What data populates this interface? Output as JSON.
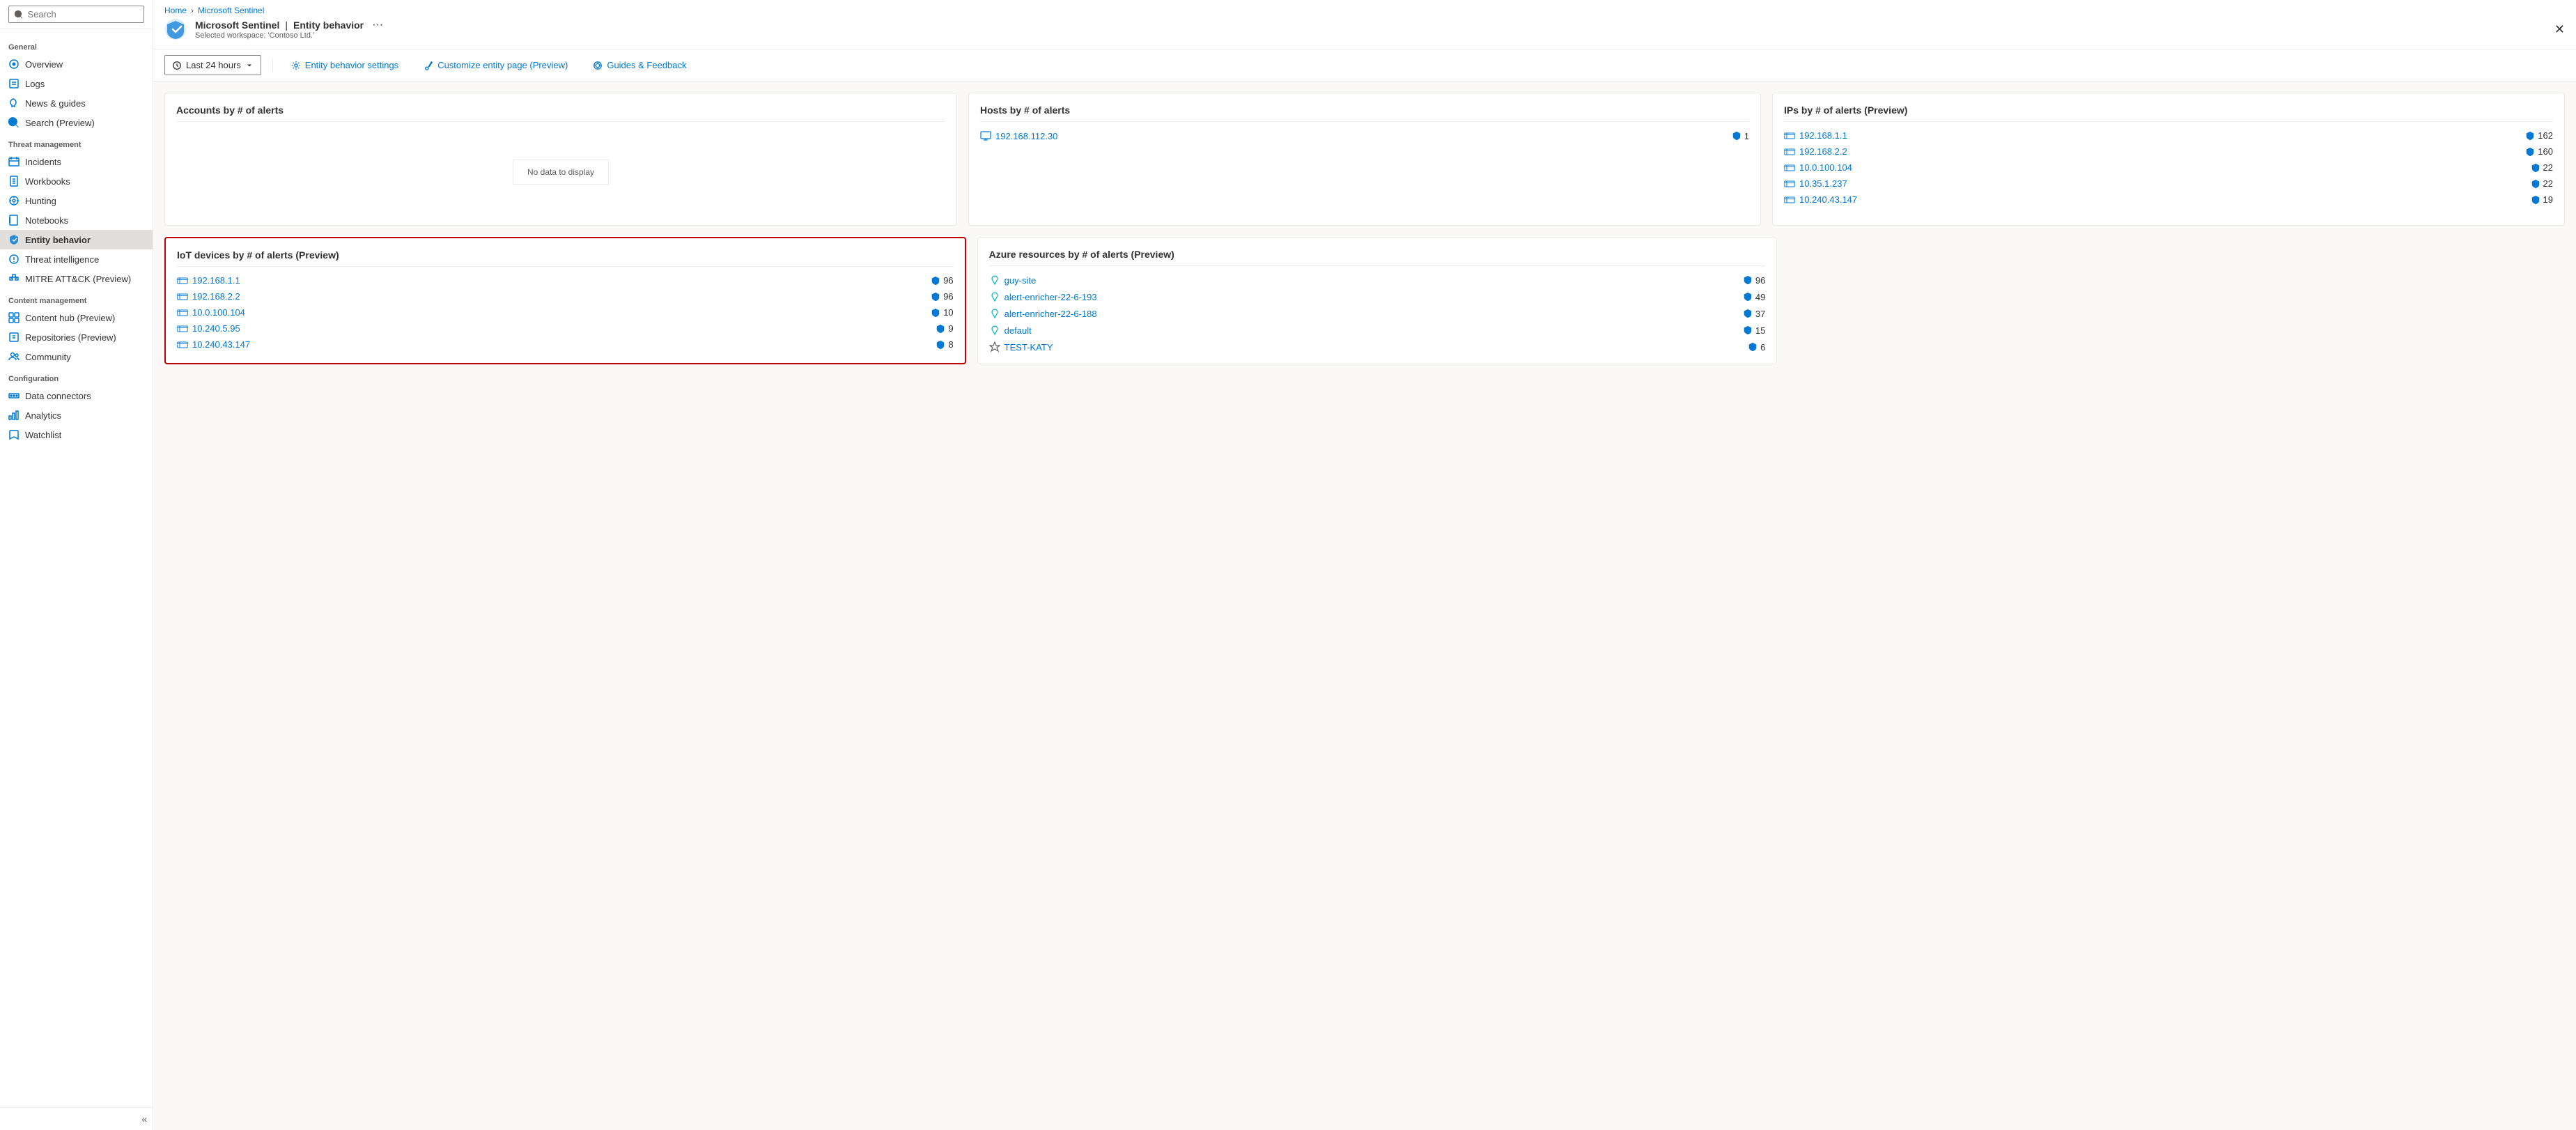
{
  "app": {
    "breadcrumb": [
      "Home",
      "Microsoft Sentinel"
    ],
    "title": "Microsoft Sentinel",
    "page": "Entity behavior",
    "workspace": "Selected workspace: 'Contoso Ltd.'",
    "more_icon": "···",
    "close_icon": "✕"
  },
  "toolbar": {
    "time_range": "Last 24 hours",
    "entity_behavior_settings": "Entity behavior settings",
    "customize_entity_page": "Customize entity page (Preview)",
    "guides_feedback": "Guides & Feedback"
  },
  "sidebar": {
    "search_placeholder": "Search",
    "collapse_label": "«",
    "sections": [
      {
        "label": "General",
        "items": [
          {
            "id": "overview",
            "label": "Overview",
            "icon": "overview"
          },
          {
            "id": "logs",
            "label": "Logs",
            "icon": "logs"
          },
          {
            "id": "news-guides",
            "label": "News & guides",
            "icon": "news"
          },
          {
            "id": "search-preview",
            "label": "Search (Preview)",
            "icon": "search"
          }
        ]
      },
      {
        "label": "Threat management",
        "items": [
          {
            "id": "incidents",
            "label": "Incidents",
            "icon": "incidents"
          },
          {
            "id": "workbooks",
            "label": "Workbooks",
            "icon": "workbooks"
          },
          {
            "id": "hunting",
            "label": "Hunting",
            "icon": "hunting"
          },
          {
            "id": "notebooks",
            "label": "Notebooks",
            "icon": "notebooks"
          },
          {
            "id": "entity-behavior",
            "label": "Entity behavior",
            "icon": "entity",
            "active": true
          },
          {
            "id": "threat-intelligence",
            "label": "Threat intelligence",
            "icon": "threat"
          },
          {
            "id": "mitre-attack",
            "label": "MITRE ATT&CK (Preview)",
            "icon": "mitre"
          }
        ]
      },
      {
        "label": "Content management",
        "items": [
          {
            "id": "content-hub",
            "label": "Content hub (Preview)",
            "icon": "hub"
          },
          {
            "id": "repositories",
            "label": "Repositories (Preview)",
            "icon": "repo"
          },
          {
            "id": "community",
            "label": "Community",
            "icon": "community"
          }
        ]
      },
      {
        "label": "Configuration",
        "items": [
          {
            "id": "data-connectors",
            "label": "Data connectors",
            "icon": "connectors"
          },
          {
            "id": "analytics",
            "label": "Analytics",
            "icon": "analytics"
          },
          {
            "id": "watchlist",
            "label": "Watchlist",
            "icon": "watchlist"
          }
        ]
      }
    ]
  },
  "accounts_card": {
    "title": "Accounts by # of alerts",
    "no_data": "No data to display",
    "items": []
  },
  "hosts_card": {
    "title": "Hosts by # of alerts",
    "items": [
      {
        "name": "192.168.112.30",
        "count": 1
      }
    ]
  },
  "ips_card": {
    "title": "IPs by # of alerts (Preview)",
    "items": [
      {
        "name": "192.168.1.1",
        "count": 162
      },
      {
        "name": "192.168.2.2",
        "count": 160
      },
      {
        "name": "10.0.100.104",
        "count": 22
      },
      {
        "name": "10.35.1.237",
        "count": 22
      },
      {
        "name": "10.240.43.147",
        "count": 19
      }
    ]
  },
  "iot_card": {
    "title": "IoT devices by # of alerts (Preview)",
    "highlighted": true,
    "items": [
      {
        "name": "192.168.1.1",
        "count": 96
      },
      {
        "name": "192.168.2.2",
        "count": 96
      },
      {
        "name": "10.0.100.104",
        "count": 10
      },
      {
        "name": "10.240.5.95",
        "count": 9
      },
      {
        "name": "10.240.43.147",
        "count": 8
      }
    ]
  },
  "azure_card": {
    "title": "Azure resources by # of alerts (Preview)",
    "items": [
      {
        "name": "guy-site",
        "count": 96
      },
      {
        "name": "alert-enricher-22-6-193",
        "count": 49
      },
      {
        "name": "alert-enricher-22-6-188",
        "count": 37
      },
      {
        "name": "default",
        "count": 15
      },
      {
        "name": "TEST-KATY",
        "count": 6,
        "icon": "star"
      }
    ]
  },
  "icons": {
    "search": "🔍",
    "chevron_down": "⌄",
    "clock": "🕐",
    "gear": "⚙",
    "paintbrush": "🖌",
    "people": "👥",
    "shield": "🛡",
    "host": "🖥",
    "ip": "📡"
  }
}
